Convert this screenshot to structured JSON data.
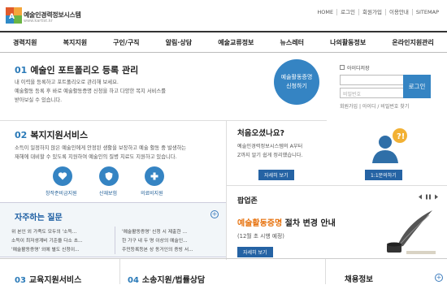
{
  "brand": {
    "name": "예술인경력정보시스템",
    "sub": "www.kartist.kr"
  },
  "topnav": [
    "HOME",
    "로그인",
    "회원가입",
    "이용안내",
    "SITEMAP"
  ],
  "mainnav": [
    "경력지원",
    "복지지원",
    "구인/구직",
    "알림·상담",
    "예술교류정보",
    "뉴스레터",
    "나의활동정보",
    "온라인지원관리"
  ],
  "portfolio": {
    "num": "01",
    "title": "예술인 포트폴리오 등록 관리",
    "line1": "내 이력을 등록하고 포트폴리오로 관리해 보세요.",
    "line2": "예술활동 등록 후 바로 예술활동증명 신청을 하고 다양한 복지 서비스를",
    "line3": "받아보실 수 있습니다.",
    "circle_line1": "예술활동증명",
    "circle_line2": "신청하기"
  },
  "login": {
    "save_id": "아이디저장",
    "id_placeholder": "",
    "pw_placeholder": "비밀번호",
    "login_button": "로그인",
    "links": "회원가입 | 아이디 / 비밀번호 찾기"
  },
  "welfare": {
    "num": "02",
    "title": "복지지원서비스",
    "line1": "소득이 일정하지 않은 예술인에게 안정된 생활을 보장하고 예술 활동 중 발생하는",
    "line2": "재해에 대비할 수 있도록 지원하여 예술인의 질병 치료도 지원하고 있습니다.",
    "items": [
      "창작준비금지원",
      "산재보험",
      "의료비지원"
    ]
  },
  "first_visit": {
    "title": "처음오셨나요?",
    "line1": "예술인경력정보시스템의 A부터",
    "line2": "Z까지 알기 쉽게 정리했습니다.",
    "button": "자세히 보기",
    "qa_button": "1:1문의하기"
  },
  "faq": {
    "title": "자주하는 질문",
    "left": [
      "위 본인 외 가족도 모두의 '소득...",
      "소득이 최저생계비 기준을 다소 초...",
      "'예술활동증명' 외에 별도 신청이..."
    ],
    "right": [
      "'예술활동증명' 신청 시 제출한 ...",
      "한 가구 내 두 명 이상의 예술인...",
      "주민등록등본 상 동거인의 증빙 서..."
    ]
  },
  "popup": {
    "title": "팝업존",
    "headline_1": "예술활동증명",
    "headline_2": " 절차 변경 안내",
    "sub": "(12월 초 시행 예정)",
    "button": "자세히 보기"
  },
  "bottom": {
    "s3_num": "03",
    "s3_title": "교육지원서비스",
    "s4_num": "04",
    "s4_title": "소송지원/법률상담",
    "jobs": "채용정보"
  }
}
